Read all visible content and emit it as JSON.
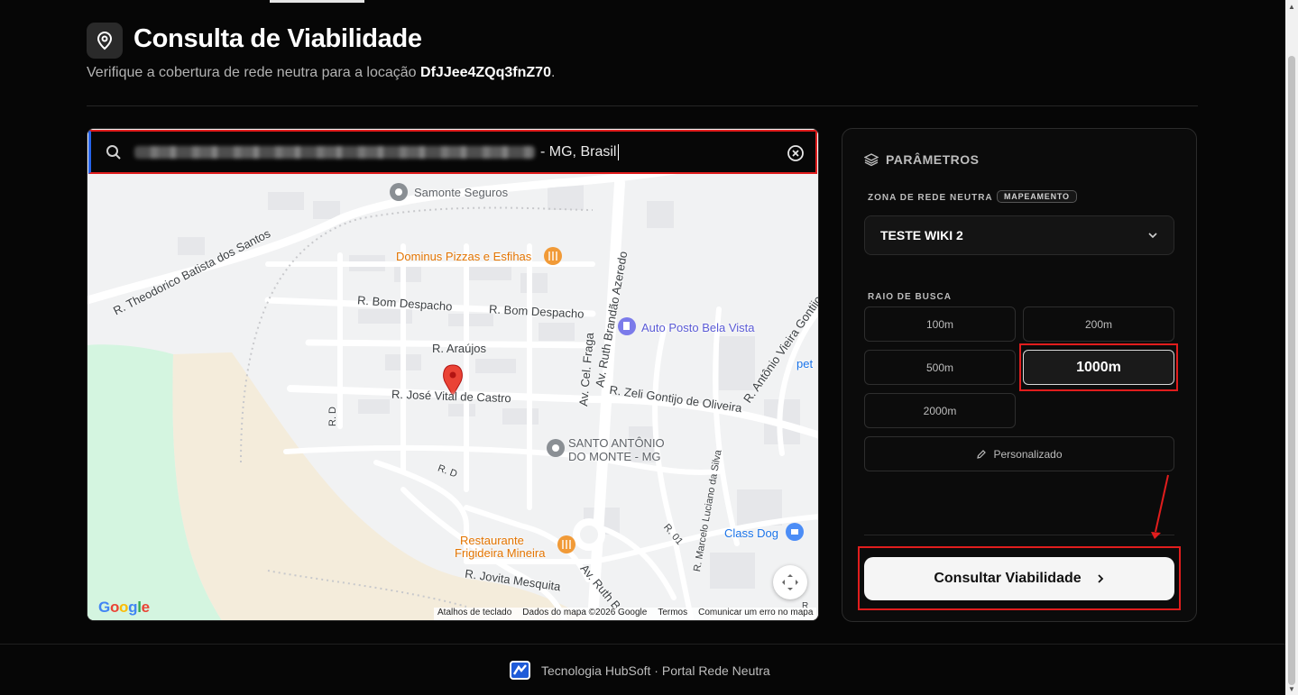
{
  "header": {
    "title": "Consulta de Viabilidade",
    "subtitle_prefix": "Verifique a cobertura de rede neutra para a locação ",
    "location_code": "DfJJee4ZQq3fnZ70",
    "subtitle_suffix": ".",
    "icon": "map-pin-icon"
  },
  "search": {
    "value_visible": "- MG, Brasil",
    "icon": "search-icon",
    "clear_icon": "clear-circle-icon"
  },
  "map": {
    "labels": {
      "samonte": "Samonte Seguros",
      "dominus": "Dominus Pizzas e Esfihas",
      "theodorico": "R. Theodorico Batista dos Santos",
      "bom_despacho_1": "R. Bom Despacho",
      "bom_despacho_2": "R. Bom Despacho",
      "ruth_brandao": "Av. Ruth Brandão Azeredo",
      "auto_posto": "Auto Posto Bela Vista",
      "araujos": "R. Araújos",
      "cel_fraga": "Av. Cel. Fraga",
      "antonio_vieira": "R. Antônio Vieira Gontijo",
      "jose_vital": "R. José Vital de Castro",
      "zeli": "R. Zeli Gontijo de Oliveira",
      "r_d_1": "R. D",
      "r_d_2": "R. D",
      "santo_antonio_1": "SANTO ANTÔNIO",
      "santo_antonio_2": "DO MONTE - MG",
      "marcelo": "R. Marcelo Luciano da Silva",
      "r01": "R. 01",
      "class_dog": "Class Dog",
      "restaurante_1": "Restaurante",
      "restaurante_2": "Frigideira Mineira",
      "jovita": "R. Jovita Mesquita",
      "ruth_2": "Av. Ruth B",
      "pet": "pet",
      "cut_r": "R"
    },
    "google_logo": "Google",
    "attribution": [
      "Atalhos de teclado",
      "Dados do mapa ©2026 Google",
      "Termos",
      "Comunicar um erro no mapa"
    ]
  },
  "params": {
    "heading": "PARÂMETROS",
    "zone_label": "ZONA DE REDE NEUTRA",
    "zone_badge": "MAPEAMENTO",
    "zone_value": "TESTE WIKI 2",
    "radius_label": "RAIO DE BUSCA",
    "radius_options": [
      "100m",
      "200m",
      "500m",
      "1000m",
      "2000m"
    ],
    "radius_selected": "1000m",
    "custom_label": "Personalizado",
    "cta_label": "Consultar Viabilidade"
  },
  "footer": {
    "text": "Tecnologia HubSoft · Portal Rede Neutra"
  },
  "colors": {
    "background": "#060606",
    "highlight_red": "#e11d1d",
    "map_pin": "#ea4335",
    "poi_orange": "#e37400",
    "poi_blue": "#5b5bd6"
  }
}
